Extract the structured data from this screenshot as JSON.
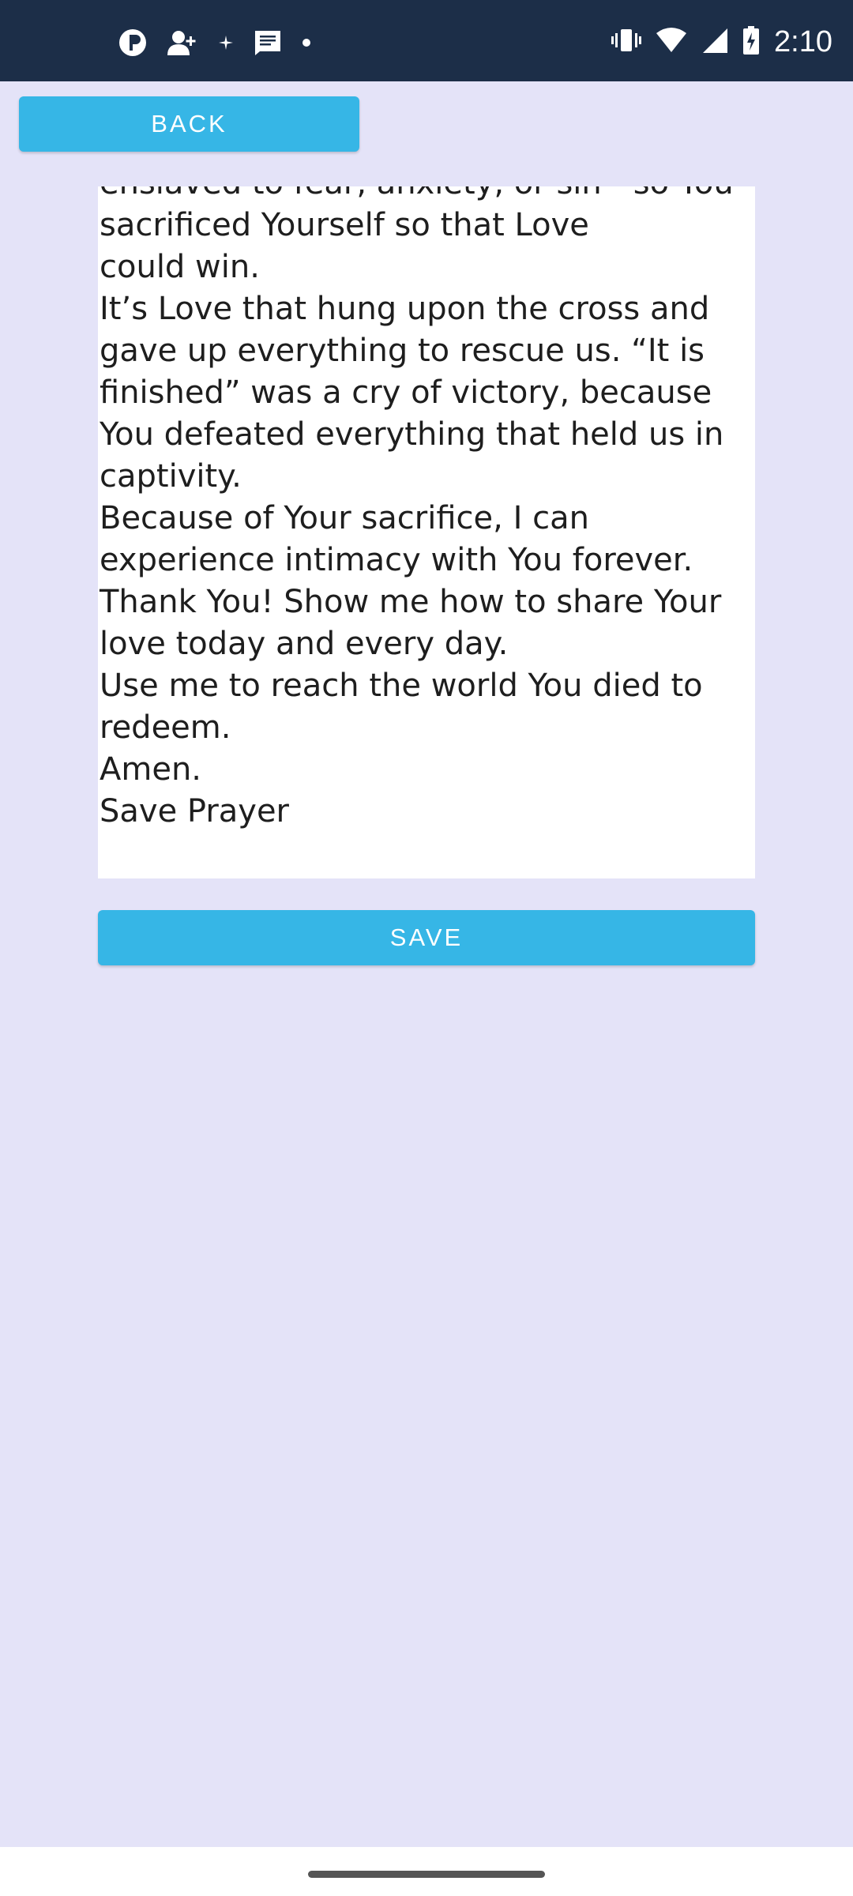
{
  "status_bar": {
    "time": "2:10",
    "left_icons": [
      "app-notification-icon",
      "add-contact-icon",
      "sparkle-icon",
      "message-icon",
      "more-notifications-dot"
    ],
    "right_icons": [
      "vibrate-icon",
      "wifi-icon",
      "cellular-signal-icon",
      "battery-charging-icon"
    ]
  },
  "toolbar": {
    "back_label": "BACK"
  },
  "prayer": {
    "lines": [
      "enslaved to fear, anxiety, or sin—so You",
      "sacrificed Yourself so that Love",
      "could win.",
      "It’s Love that hung upon the cross and",
      "gave up everything to rescue us. “It is",
      "finished” was a cry of victory, because",
      "You defeated everything that held us in",
      "captivity.",
      "Because of Your sacrifice, I can",
      "experience intimacy with You forever.",
      "Thank You! Show me how to share Your",
      "love today and every day.",
      "Use me to reach the world You died to",
      "redeem.",
      "Amen.",
      "Save Prayer"
    ]
  },
  "actions": {
    "save_label": "SAVE"
  },
  "colors": {
    "status_bar_bg": "#1c2e48",
    "page_bg": "#e4e3f8",
    "button_bg": "#36b6e6",
    "button_text": "#ffffff",
    "text_box_bg": "#ffffff",
    "body_text": "#1e1e1e"
  }
}
